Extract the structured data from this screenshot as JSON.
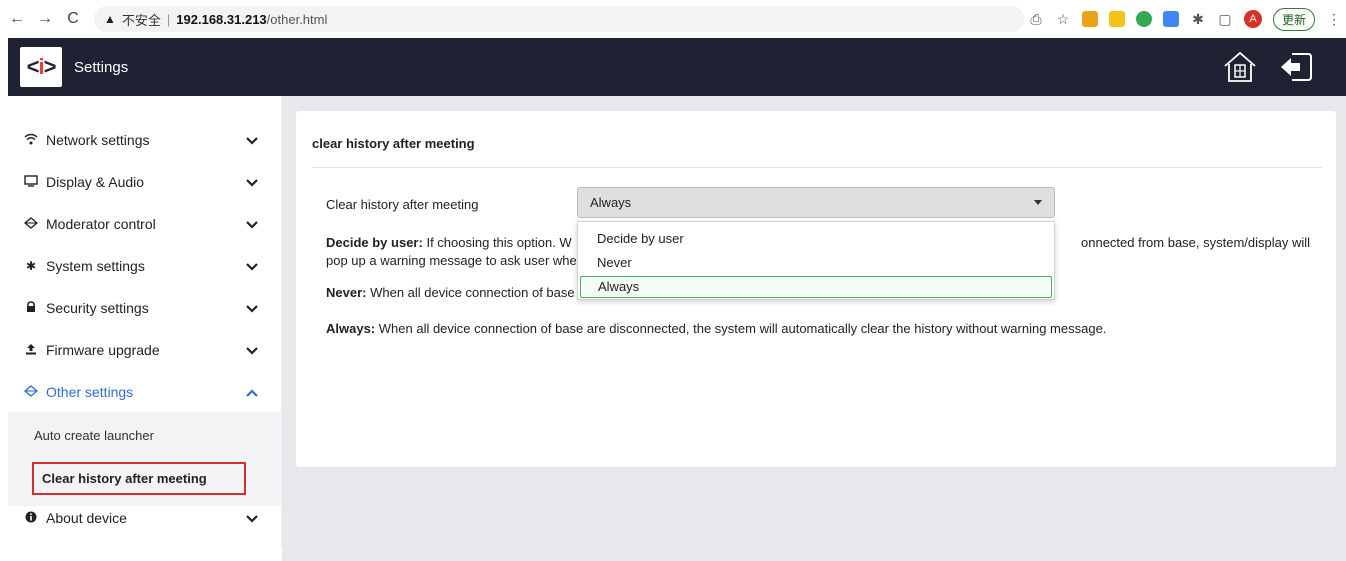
{
  "browser": {
    "back": "←",
    "forward": "→",
    "reload": "C",
    "insecure_label": "不安全",
    "host": "192.168.31.213",
    "path": "/other.html",
    "update_label": "更新",
    "profile_initial": "A"
  },
  "header": {
    "title": "Settings",
    "logo_text": "<i>"
  },
  "sidebar": {
    "items": [
      {
        "label": "Network settings",
        "icon": "wifi-icon"
      },
      {
        "label": "Display & Audio",
        "icon": "monitor-icon"
      },
      {
        "label": "Moderator control",
        "icon": "diamond-icon"
      },
      {
        "label": "System settings",
        "icon": "gear-icon"
      },
      {
        "label": "Security settings",
        "icon": "lock-icon"
      },
      {
        "label": "Firmware upgrade",
        "icon": "upload-icon"
      },
      {
        "label": "Other settings",
        "icon": "diamond-icon",
        "active": true
      },
      {
        "label": "About device",
        "icon": "info-icon"
      }
    ],
    "submenu": [
      {
        "label": "Auto create launcher"
      },
      {
        "label": "Clear history after meeting",
        "current": true
      }
    ]
  },
  "main": {
    "section_title": "clear history after meeting",
    "field_label": "Clear history after meeting",
    "select_value": "Always",
    "descriptions": {
      "user_title": "Decide by user:",
      "user_text_a": "If choosing this option. W",
      "user_text_b": "onnected from base, system/display will",
      "user_text_line2": "pop up a warning message to ask user whe",
      "never_title": "Never:",
      "never_text": "When all device connection of base",
      "always_title": "Always:",
      "always_text": "When all device connection of base are disconnected, the system will automatically clear the history without warning message."
    },
    "dropdown_options": [
      "Decide by user",
      "Never",
      "Always"
    ]
  },
  "colors": {
    "header_bg": "#1e2233",
    "active_blue": "#2f6fd1",
    "highlight_red": "#d32f2f",
    "selected_green": "#4caf50",
    "content_bg": "#e7e8ec"
  }
}
